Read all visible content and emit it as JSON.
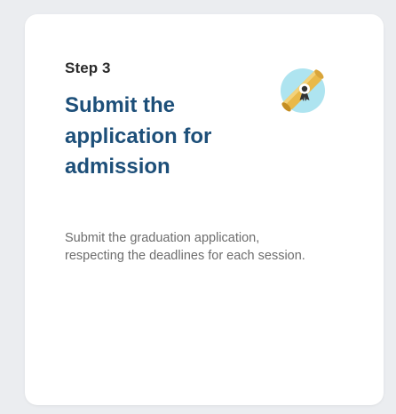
{
  "card": {
    "step_label": "Step 3",
    "title": "Submit the application for admission",
    "description": "Submit the graduation application, respecting the deadlines for each session.",
    "icon": "diploma-icon"
  },
  "colors": {
    "title": "#1d4f79",
    "icon_circle": "#aee4f0",
    "diploma": "#e9b949"
  }
}
